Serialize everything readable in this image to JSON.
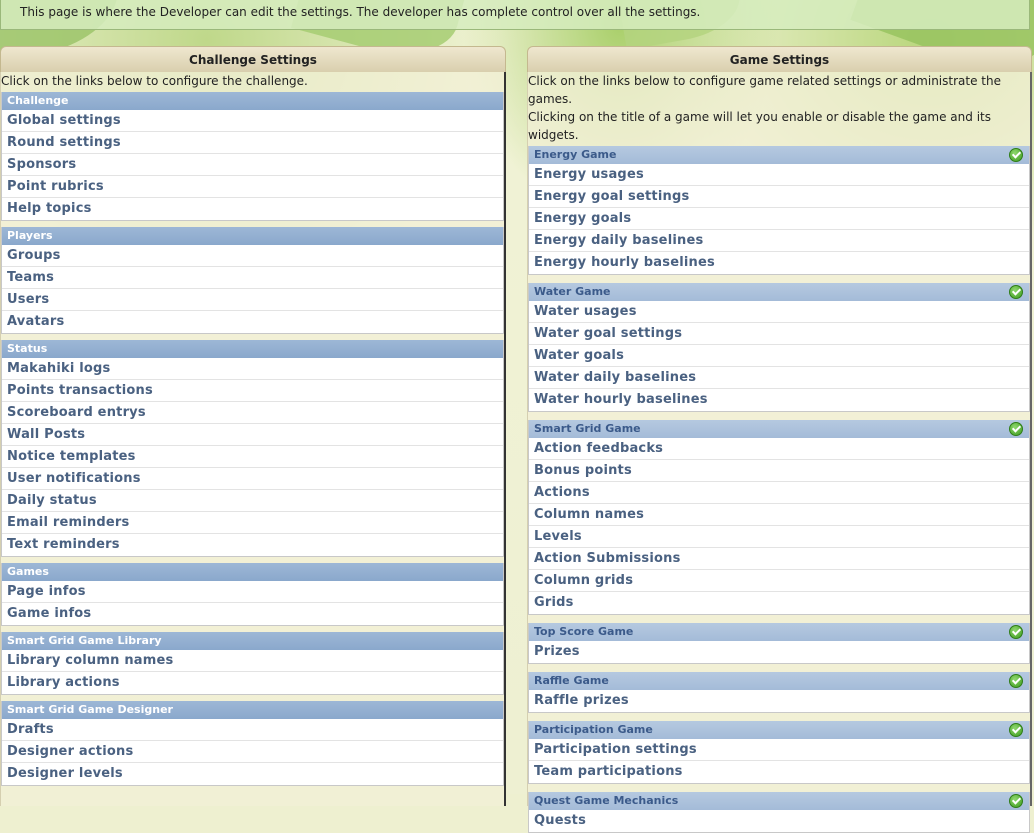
{
  "banner": {
    "message": "This page is where the Developer can edit the settings. The developer has complete control over all the settings."
  },
  "challenge_panel": {
    "title": "Challenge Settings",
    "intro": "Click on the links below to configure the challenge.",
    "modules": [
      {
        "caption": "Challenge",
        "items": [
          "Global settings",
          "Round settings",
          "Sponsors",
          "Point rubrics",
          "Help topics"
        ]
      },
      {
        "caption": "Players",
        "items": [
          "Groups",
          "Teams",
          "Users",
          "Avatars"
        ]
      },
      {
        "caption": "Status",
        "items": [
          "Makahiki logs",
          "Points transactions",
          "Scoreboard entrys",
          "Wall Posts",
          "Notice templates",
          "User notifications",
          "Daily status",
          "Email reminders",
          "Text reminders"
        ]
      },
      {
        "caption": "Games",
        "items": [
          "Page infos",
          "Game infos"
        ]
      },
      {
        "caption": "Smart Grid Game Library",
        "items": [
          "Library column names",
          "Library actions"
        ]
      },
      {
        "caption": "Smart Grid Game Designer",
        "items": [
          "Drafts",
          "Designer actions",
          "Designer levels"
        ]
      }
    ]
  },
  "game_panel": {
    "title": "Game Settings",
    "intro_lines": [
      "Click on the links below to configure game related settings or administrate the games.",
      "Clicking on the title of a game will let you enable or disable the game and its widgets."
    ],
    "modules": [
      {
        "caption": "Energy Game",
        "enabled": true,
        "items": [
          "Energy usages",
          "Energy goal settings",
          "Energy goals",
          "Energy daily baselines",
          "Energy hourly baselines"
        ]
      },
      {
        "caption": "Water Game",
        "enabled": true,
        "items": [
          "Water usages",
          "Water goal settings",
          "Water goals",
          "Water daily baselines",
          "Water hourly baselines"
        ]
      },
      {
        "caption": "Smart Grid Game",
        "enabled": true,
        "items": [
          "Action feedbacks",
          "Bonus points",
          "Actions",
          "Column names",
          "Levels",
          "Action Submissions",
          "Column grids",
          "Grids"
        ]
      },
      {
        "caption": "Top Score Game",
        "enabled": true,
        "items": [
          "Prizes"
        ]
      },
      {
        "caption": "Raffle Game",
        "enabled": true,
        "items": [
          "Raffle prizes"
        ]
      },
      {
        "caption": "Participation Game",
        "enabled": true,
        "items": [
          "Participation settings",
          "Team participations"
        ]
      },
      {
        "caption": "Quest Game Mechanics",
        "enabled": true,
        "items": [
          "Quests"
        ]
      }
    ]
  },
  "icons": {
    "enabled": "green-check-icon"
  },
  "colors": {
    "link": "#4a6181",
    "caption_left": "#8aa8cc",
    "caption_right": "#a4bbd8",
    "check": "#3c9a1e"
  }
}
